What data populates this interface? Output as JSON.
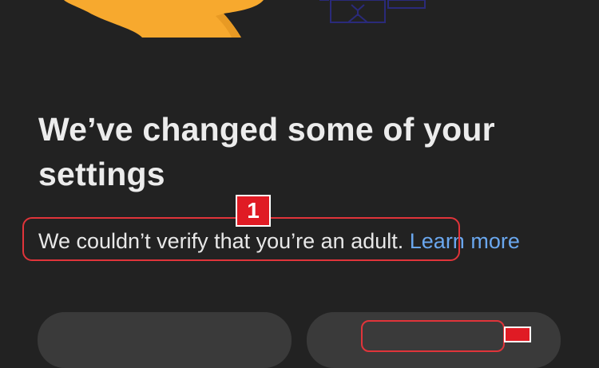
{
  "dialog": {
    "title": "We’ve changed some of your settings",
    "message": "We couldn’t verify that you’re an adult.",
    "learn_more": "Learn more"
  },
  "annotations": {
    "badge_1": "1",
    "badge_2": ""
  },
  "colors": {
    "background": "#222222",
    "illustration_orange": "#f7a92e",
    "link": "#6aa7ee",
    "annotation_red": "#e0343a",
    "button_bg": "#3a3a3a"
  },
  "icons": {
    "illustration": "person-with-orange-cloud-illustration"
  }
}
